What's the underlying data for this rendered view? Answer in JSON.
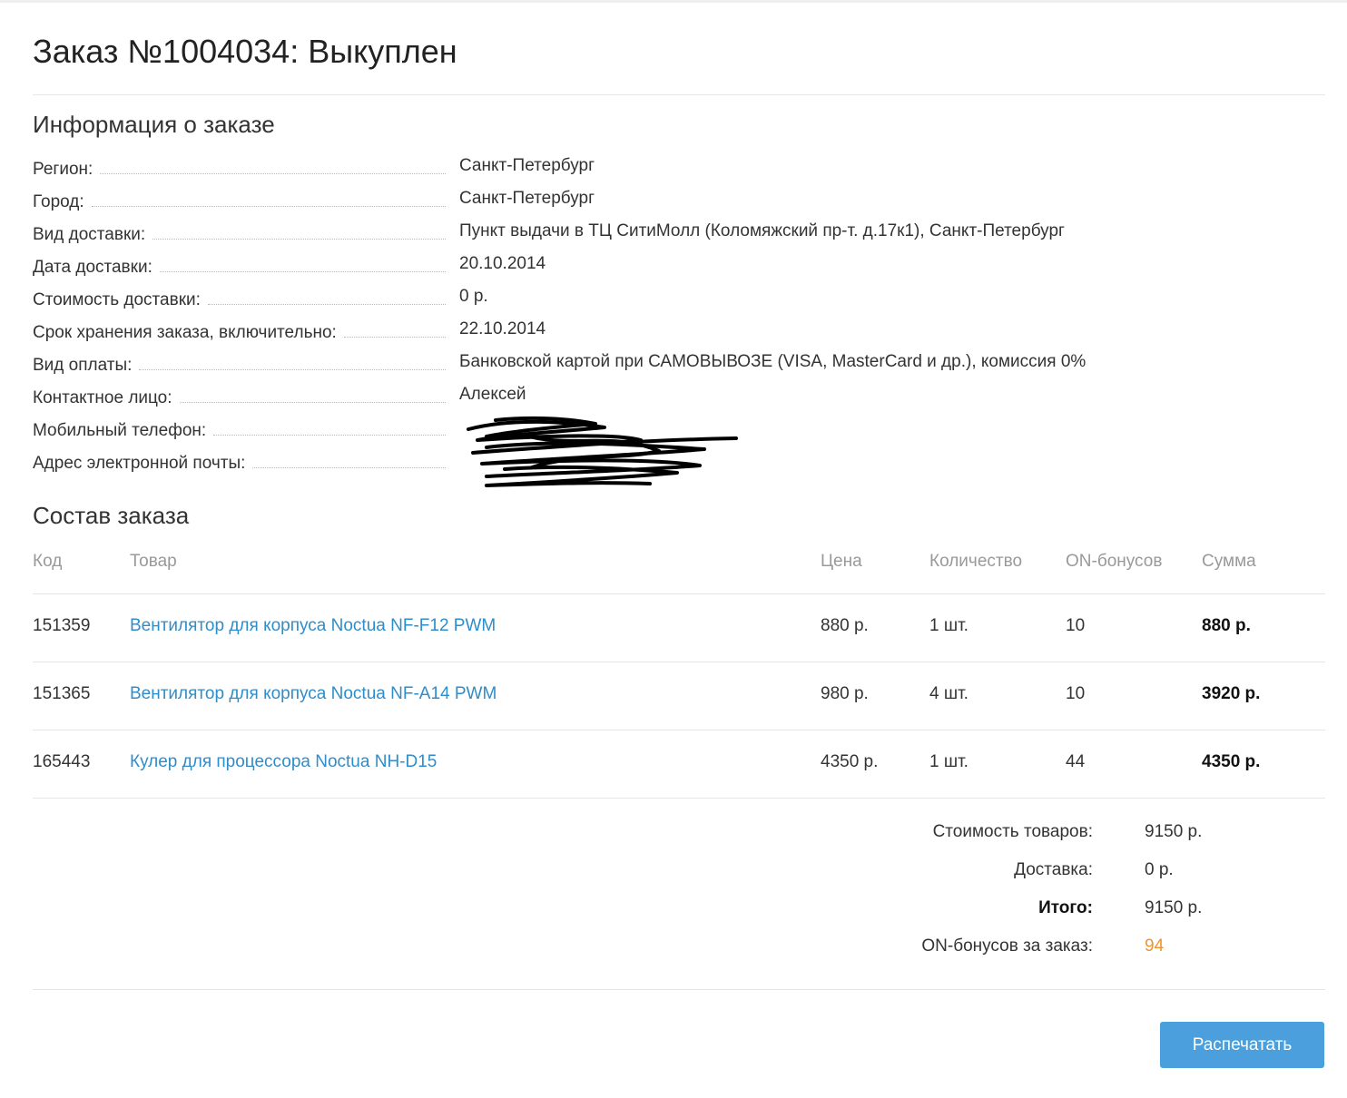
{
  "order": {
    "title": "Заказ №1004034: Выкуплен"
  },
  "info": {
    "heading": "Информация о заказе",
    "rows": [
      {
        "label": "Регион:",
        "value": "Санкт-Петербург"
      },
      {
        "label": "Город:",
        "value": "Санкт-Петербург"
      },
      {
        "label": "Вид доставки:",
        "value": "Пункт выдачи в ТЦ СитиМолл (Коломяжский пр-т. д.17к1), Санкт-Петербург"
      },
      {
        "label": "Дата доставки:",
        "value": "20.10.2014"
      },
      {
        "label": "Стоимость доставки:",
        "value": "0 р."
      },
      {
        "label": "Срок хранения заказа, включительно:",
        "value": "22.10.2014"
      },
      {
        "label": "Вид оплаты:",
        "value": "Банковской картой при САМОВЫВОЗЕ (VISA, MasterCard и др.), комиссия 0%"
      },
      {
        "label": "Контактное лицо:",
        "value": "Алексей"
      },
      {
        "label": "Мобильный телефон:",
        "value": ""
      },
      {
        "label": "Адрес электронной почты:",
        "value": ""
      }
    ]
  },
  "items": {
    "heading": "Состав заказа",
    "columns": [
      "Код",
      "Товар",
      "Цена",
      "Количество",
      "ON-бонусов",
      "Сумма"
    ],
    "rows": [
      {
        "code": "151359",
        "name": "Вентилятор для корпуса Noctua NF-F12 PWM",
        "price": "880 р.",
        "qty": "1 шт.",
        "bonus": "10",
        "sum": "880 р."
      },
      {
        "code": "151365",
        "name": "Вентилятор для корпуса Noctua NF-A14 PWM",
        "price": "980 р.",
        "qty": "4 шт.",
        "bonus": "10",
        "sum": "3920 р."
      },
      {
        "code": "165443",
        "name": "Кулер для процессора Noctua NH-D15",
        "price": "4350 р.",
        "qty": "1 шт.",
        "bonus": "44",
        "sum": "4350 р."
      }
    ]
  },
  "totals": {
    "goods_label": "Стоимость товаров:",
    "goods_value": "9150 р.",
    "delivery_label": "Доставка:",
    "delivery_value": "0 р.",
    "total_label": "Итого:",
    "total_value": "9150 р.",
    "bonus_label": "ON-бонусов за заказ:",
    "bonus_value": "94"
  },
  "actions": {
    "print_label": "Распечатать"
  },
  "colors": {
    "link": "#2f8dc9",
    "bonus": "#f0932b",
    "button": "#4a9fdc"
  }
}
